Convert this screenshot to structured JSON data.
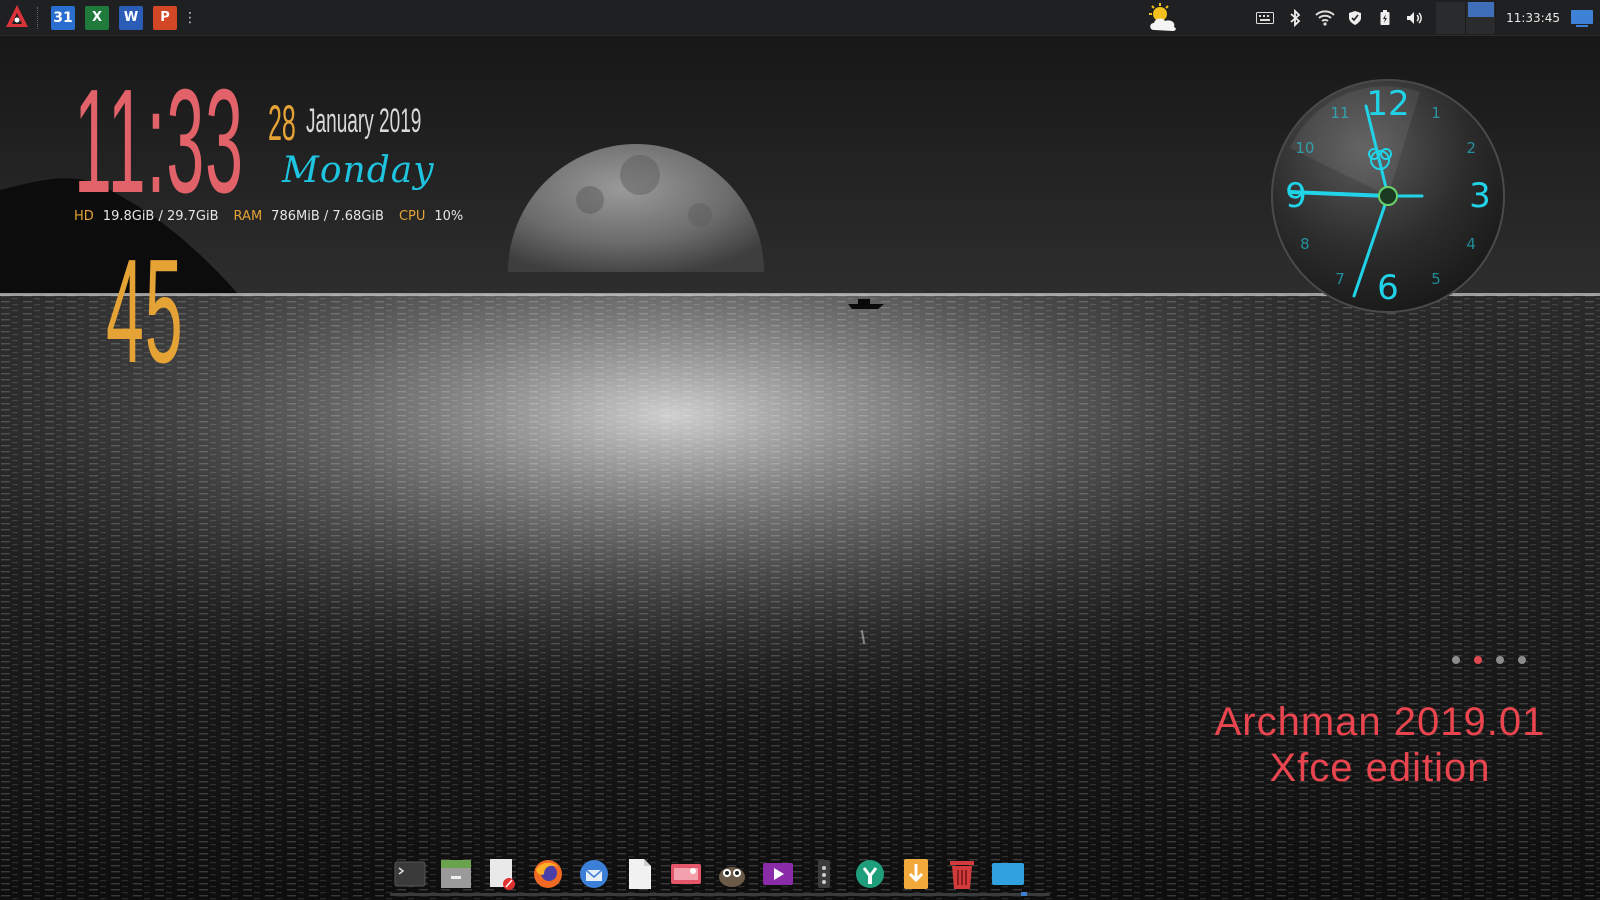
{
  "top_panel": {
    "launchers": [
      {
        "name": "archman-menu",
        "icon": "archman-logo-icon"
      },
      {
        "name": "calendar",
        "icon": "calendar-icon",
        "text": "31"
      },
      {
        "name": "excel",
        "icon": "excel-icon",
        "text": "X"
      },
      {
        "name": "word",
        "icon": "word-icon",
        "text": "W"
      },
      {
        "name": "powerpoint",
        "icon": "powerpoint-icon",
        "text": "P"
      }
    ],
    "more_glyph": "⋮",
    "weather_icon": "partly-cloudy-icon",
    "tray": [
      "keyboard-icon",
      "bluetooth-icon",
      "wifi-icon",
      "shield-icon",
      "battery-icon",
      "volume-icon"
    ],
    "clock": "11:33:45"
  },
  "conky": {
    "hour": "11:33",
    "minute": "45",
    "day_number": "28",
    "month_year": "January 2019",
    "weekday": "Monday",
    "stats": [
      {
        "label": "HD",
        "value": "19.8GiB / 29.7GiB"
      },
      {
        "label": "RAM",
        "value": "786MiB / 7.68GiB"
      },
      {
        "label": "CPU",
        "value": "10%"
      }
    ]
  },
  "analog_clock": {
    "numerals": [
      "12",
      "1",
      "2",
      "3",
      "4",
      "5",
      "6",
      "7",
      "8",
      "9",
      "10",
      "11"
    ],
    "color": "#21d3e8"
  },
  "page_dots": {
    "count": 4,
    "active_index": 1
  },
  "branding": {
    "line1": "Archman 2019.01",
    "line2": "Xfce edition",
    "color": "#e8454e"
  },
  "dock": [
    "terminal-icon",
    "file-manager-icon",
    "text-editor-icon",
    "firefox-icon",
    "thunderbird-icon",
    "document-icon",
    "screenshot-icon",
    "gimp-icon",
    "media-player-icon",
    "settings-icon",
    "software-center-icon",
    "downloader-icon",
    "trash-icon",
    "desktop-folder-icon"
  ],
  "colors": {
    "hour": "#e2626a",
    "minute": "#e5a235",
    "weekday": "#1fc5e0",
    "panel": "#1f2021"
  }
}
